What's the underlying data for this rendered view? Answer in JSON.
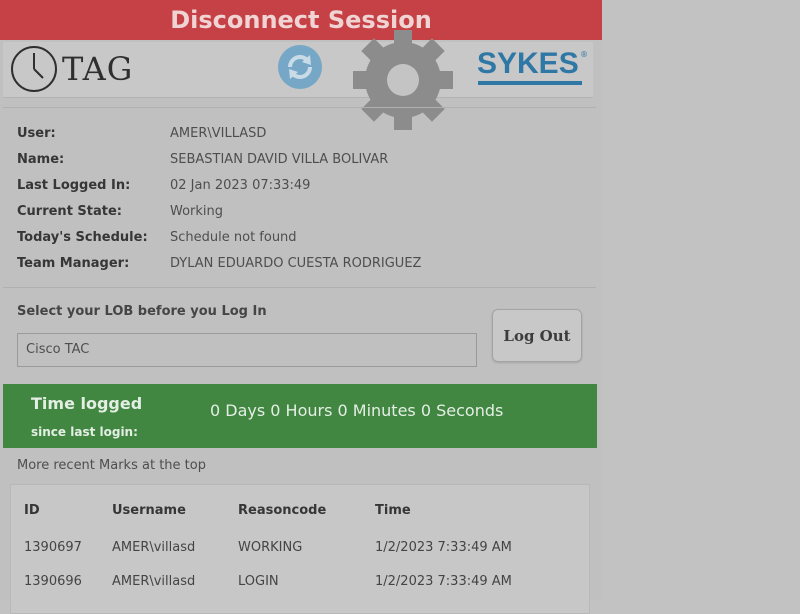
{
  "window": {
    "title": "Disconnect Session"
  },
  "header": {
    "tag_logo_text": "TAG",
    "brand": "SYKES",
    "brand_reg": "®",
    "brand_color": "#2f78a6"
  },
  "user_info": [
    {
      "label": "User:",
      "value": "AMER\\VILLASD"
    },
    {
      "label": "Name:",
      "value": "SEBASTIAN DAVID VILLA BOLIVAR"
    },
    {
      "label": "Last Logged In:",
      "value": "02 Jan 2023 07:33:49"
    },
    {
      "label": "Current State:",
      "value": "Working"
    },
    {
      "label": "Today's Schedule:",
      "value": "Schedule not found"
    },
    {
      "label": "Team Manager:",
      "value": "DYLAN EDUARDO CUESTA RODRIGUEZ"
    }
  ],
  "lob": {
    "label": "Select your LOB before you Log In",
    "value": "Cisco TAC"
  },
  "logout_label": "Log Out",
  "time_logged": {
    "title": "Time logged",
    "subtitle": "since last login:",
    "value": "0 Days 0 Hours 0 Minutes 0 Seconds",
    "color": "#418742"
  },
  "recent_note": "More recent Marks at the top",
  "marks_table": {
    "headers": [
      "ID",
      "Username",
      "Reasoncode",
      "Time"
    ],
    "rows": [
      [
        "1390697",
        "AMER\\villasd",
        "WORKING",
        "1/2/2023 7:33:49 AM"
      ],
      [
        "1390696",
        "AMER\\villasd",
        "LOGIN",
        "1/2/2023 7:33:49 AM"
      ]
    ]
  },
  "colors": {
    "titlebar": "#c64146"
  }
}
